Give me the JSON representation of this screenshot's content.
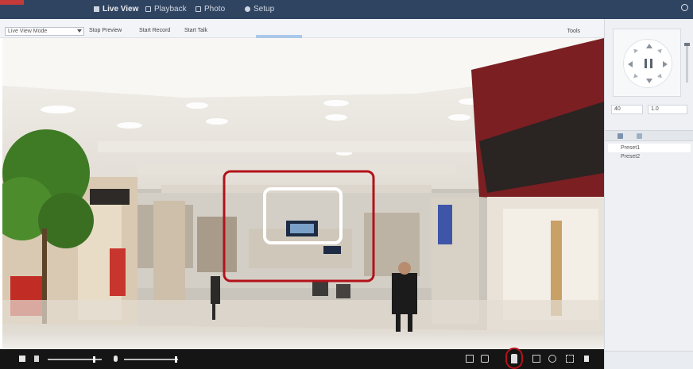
{
  "app": {
    "nav": [
      {
        "label": "Live View",
        "active": true
      },
      {
        "label": "Playback",
        "active": false
      },
      {
        "label": "Photo",
        "active": false
      },
      {
        "label": "Setup",
        "active": false
      }
    ],
    "user": ""
  },
  "toolbar": {
    "stream_select": "Live View Mode",
    "buttons": [
      "Stop Preview",
      "Start Record",
      "Start Talk"
    ],
    "right_label": "Tools"
  },
  "video": {
    "highlights": {
      "outer": {
        "color": "#b3121a",
        "label": "zoom region"
      },
      "inner": {
        "color": "#ffffff",
        "label": "focus area"
      }
    }
  },
  "controls": {
    "volume_level": 0.85,
    "mic_level": 0.95,
    "highlighted_button": "3d-positioning-icon",
    "highlight_color": "#b3121a"
  },
  "ptz": {
    "fields": [
      "40",
      "1.0"
    ],
    "presets": [
      "Preset1",
      "Preset2"
    ]
  },
  "colors": {
    "nav_bg": "#2f4461",
    "control_bar_bg": "#151515",
    "panel_bg": "#eef0f3"
  }
}
